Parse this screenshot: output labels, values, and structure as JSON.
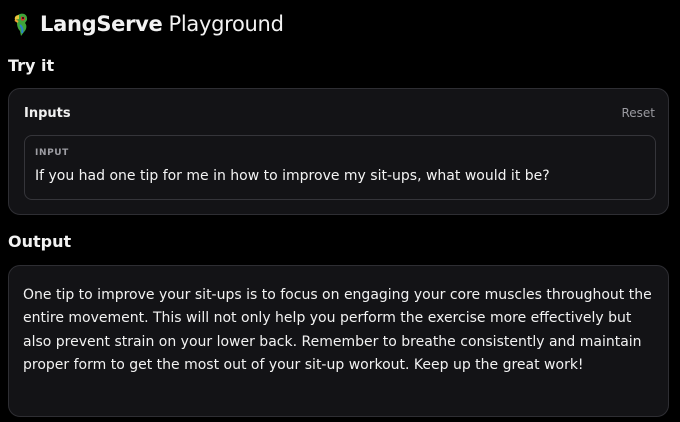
{
  "header": {
    "icon": "parrot-icon",
    "brand": "LangServe",
    "subtitle": "Playground"
  },
  "try_it": {
    "title": "Try it",
    "inputs_label": "Inputs",
    "reset_label": "Reset",
    "field": {
      "label": "INPUT",
      "value": "If you had one tip for me in how to improve my sit-ups, what would it be?"
    }
  },
  "output": {
    "title": "Output",
    "text": "One tip to improve your sit-ups is to focus on engaging your core muscles throughout the entire movement. This will not only help you perform the exercise more effectively but also prevent strain on your lower back. Remember to breathe consistently and maintain proper form to get the most out of your sit-up workout. Keep up the great work!"
  },
  "colors": {
    "background": "#000000",
    "card": "#131316",
    "border": "#2e2e33",
    "muted_text": "#9a9aa0"
  }
}
